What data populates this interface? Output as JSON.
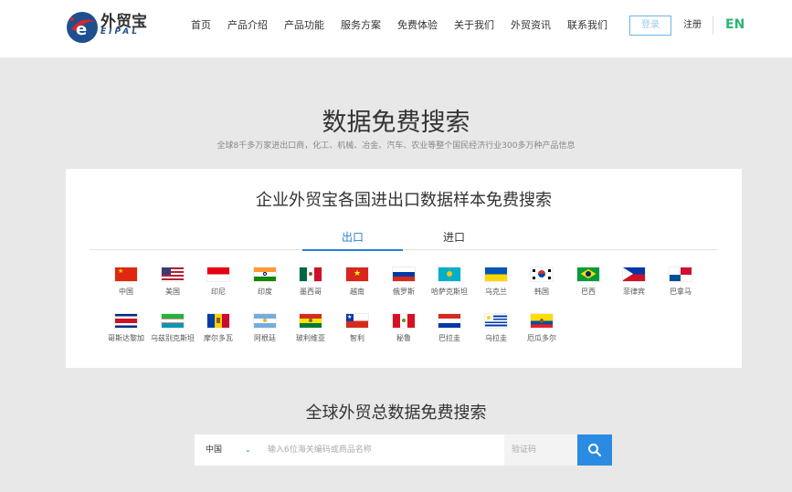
{
  "header": {
    "logo_text": "外贸宝",
    "logo_sub": "EIPAL",
    "nav": [
      "首页",
      "产品介绍",
      "产品功能",
      "服务方案",
      "免费体验",
      "关于我们",
      "外贸资讯",
      "联系我们"
    ],
    "login": "登录",
    "register": "注册",
    "lang": "EN"
  },
  "hero": {
    "title": "数据免费搜索",
    "subtitle": "全球8千多万家进出口商，化工、机械、冶金、汽车、农业等整个国民经济行业300多万种产品信息"
  },
  "card": {
    "title": "企业外贸宝各国进出口数据样本免费搜索",
    "tabs": [
      "出口",
      "进口"
    ],
    "countries": [
      "中国",
      "美国",
      "印尼",
      "印度",
      "墨西哥",
      "越南",
      "俄罗斯",
      "哈萨克斯坦",
      "乌克兰",
      "韩国",
      "巴西",
      "菲律宾",
      "巴拿马",
      "哥斯达黎加",
      "乌兹别克斯坦",
      "摩尔多瓦",
      "阿根廷",
      "玻利维亚",
      "智利",
      "秘鲁",
      "巴拉圭",
      "乌拉圭",
      "厄瓜多尔"
    ]
  },
  "search": {
    "title": "全球外贸总数据免费搜索",
    "country_selected": "中国",
    "keyword_placeholder": "输入6位海关编码或商品名称",
    "code_placeholder": "验证码"
  }
}
